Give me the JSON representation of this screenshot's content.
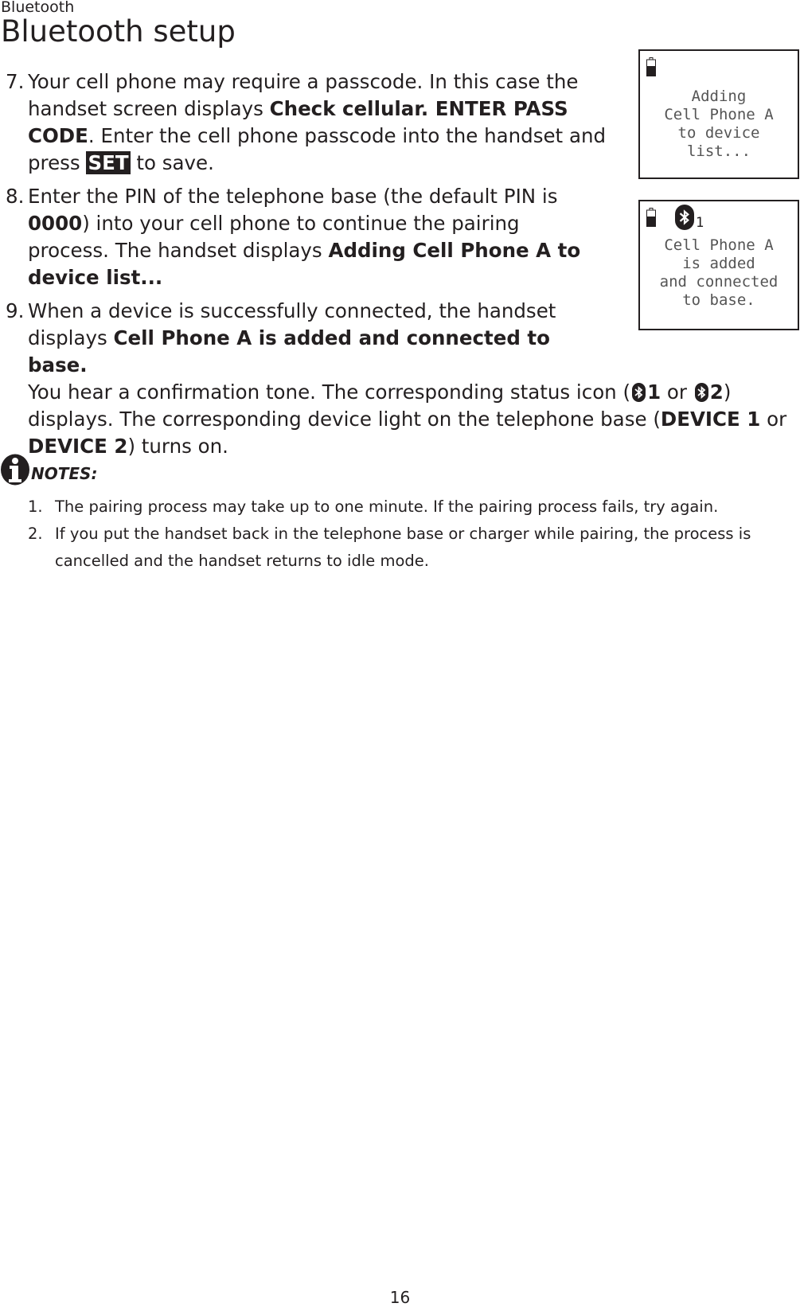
{
  "header": {
    "section": "Bluetooth",
    "title": "Bluetooth setup"
  },
  "steps": [
    {
      "number": "7.",
      "parts": {
        "t1": "Your cell phone may require a passcode. In this case the handset screen displays ",
        "b1": "Check cellular. ENTER PASS CODE",
        "t2": ". Enter the cell phone passcode into the handset and press ",
        "key": "SET",
        "t3": " to save."
      }
    },
    {
      "number": "8.",
      "parts": {
        "t1": "Enter the PIN of the telephone base (the default PIN is ",
        "b1": "0000",
        "t2": ") into your cell phone to continue the pairing process. The handset displays ",
        "b2": "Adding Cell Phone A to device list..."
      }
    },
    {
      "number": "9.",
      "parts": {
        "t1": "When a device is successfully connected, the handset displays ",
        "b1": "Cell Phone A is added and connected to base.",
        "t2": "You hear a confirmation tone. The corresponding status icon (",
        "b2": "1",
        "t3": " or ",
        "b3": "2",
        "t4": ") displays. The corresponding device light on the telephone base (",
        "b4": "DEVICE 1",
        "t5": " or ",
        "b5": "DEVICE 2",
        "t6": ") turns on."
      }
    }
  ],
  "screens": [
    {
      "icons": [
        "battery-icon"
      ],
      "lines": [
        "Adding",
        "Cell Phone A",
        "to device",
        "list..."
      ]
    },
    {
      "icons": [
        "battery-icon",
        "bluetooth-icon"
      ],
      "bt_index": "1",
      "lines": [
        "Cell Phone A",
        "is added",
        "and connected",
        "to base."
      ]
    }
  ],
  "notes": {
    "label": "NOTES:",
    "items": [
      {
        "number": "1.",
        "text": "The pairing process may take up to one minute. If the pairing process fails, try again."
      },
      {
        "number": "2.",
        "text": "If you put the handset back in the telephone base or charger while pairing, the process is cancelled and the handset returns to idle mode."
      }
    ]
  },
  "footer": {
    "page_number": "16"
  }
}
